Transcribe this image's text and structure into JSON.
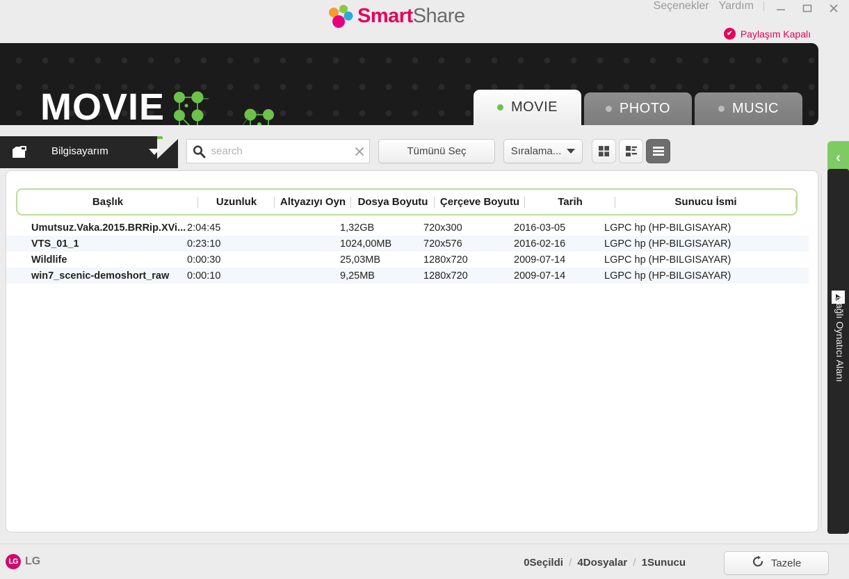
{
  "titlebar": {
    "brand_smart": "Smart",
    "brand_share": "Share",
    "menu": [
      {
        "label": "Seçenekler"
      },
      {
        "label": "Yardım"
      }
    ],
    "window_controls": {
      "minimize": "—",
      "maximize": "❐",
      "close": "✕"
    },
    "share_status": {
      "label": "Paylaşım Kapalı",
      "icon": "check-circle-icon",
      "color": "#e6005a"
    }
  },
  "banner": {
    "title": "MOVIE",
    "background": "#1b1b1b",
    "accent": "#6cc24a"
  },
  "tabs": [
    {
      "label": "MOVIE",
      "active": true
    },
    {
      "label": "PHOTO",
      "active": false
    },
    {
      "label": "MUSIC",
      "active": false
    }
  ],
  "toolbar": {
    "source": {
      "label": "Bilgisayarım",
      "icon": "computer-folder-icon"
    },
    "search": {
      "value": "",
      "placeholder": "search",
      "clear": "✕"
    },
    "select_all_label": "Tümünü Seç",
    "sort_label": "Sıralama...",
    "views": [
      {
        "name": "grid-view",
        "active": false
      },
      {
        "name": "detail-view",
        "active": false
      },
      {
        "name": "list-view",
        "active": true
      }
    ]
  },
  "table": {
    "columns": [
      {
        "label": "Başlık",
        "key": "title"
      },
      {
        "label": "Uzunluk",
        "key": "length"
      },
      {
        "label": "Altyazıyı Oyn",
        "key": "subtitle"
      },
      {
        "label": "Dosya Boyutu",
        "key": "size"
      },
      {
        "label": "Çerçeve Boyutu",
        "key": "frame"
      },
      {
        "label": "Tarih",
        "key": "date"
      },
      {
        "label": "Sunucu İsmi",
        "key": "server"
      }
    ],
    "rows": [
      {
        "title": "Umutsuz.Vaka.2015.BRRip.XVi...",
        "length": "2:04:45",
        "subtitle": "",
        "size": "1,32GB",
        "frame": "720x300",
        "date": "2016-03-05",
        "server": "LGPC hp (HP-BILGISAYAR)"
      },
      {
        "title": "VTS_01_1",
        "length": "0:23:10",
        "subtitle": "",
        "size": "1024,00MB",
        "frame": "720x576",
        "date": "2016-02-16",
        "server": "LGPC hp (HP-BILGISAYAR)"
      },
      {
        "title": "Wildlife",
        "length": "0:00:30",
        "subtitle": "",
        "size": "25,03MB",
        "frame": "1280x720",
        "date": "2009-07-14",
        "server": "LGPC hp (HP-BILGISAYAR)"
      },
      {
        "title": "win7_scenic-demoshort_raw",
        "length": "0:00:10",
        "subtitle": "",
        "size": "9,25MB",
        "frame": "1280x720",
        "date": "2009-07-14",
        "server": "LGPC hp (HP-BILGISAYAR)"
      }
    ]
  },
  "dock": {
    "label": "Bağlı Oynatıcı Alanı",
    "collapse_icon": "chevron-left-icon",
    "player_icon": "play-icon"
  },
  "footer": {
    "logo_text": "LG",
    "logo_mark": "LG",
    "status": {
      "selected": "0Seçildi",
      "files": "4Dosyalar",
      "servers": "1Sunucu",
      "separator": "/"
    },
    "refresh_label": "Tazele",
    "refresh_icon": "refresh-icon"
  }
}
